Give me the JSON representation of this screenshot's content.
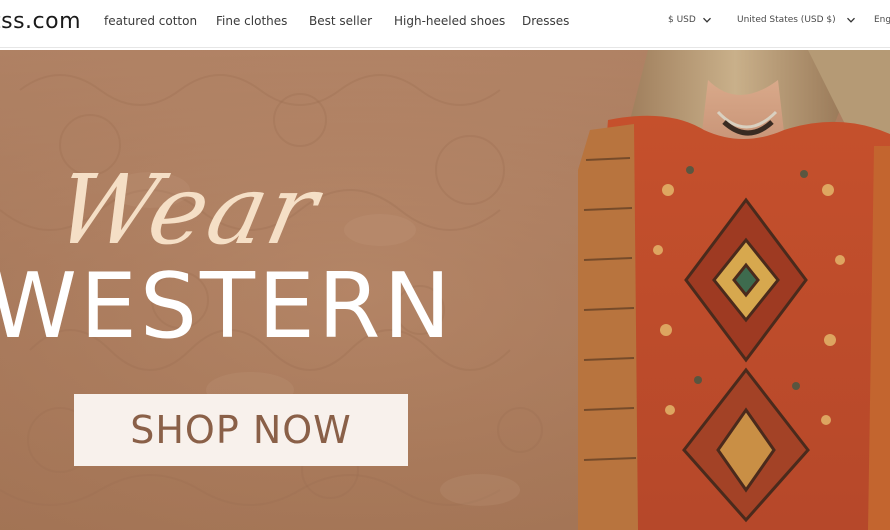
{
  "header": {
    "logo_text": "tss.com",
    "nav": [
      {
        "label": "featured cotton"
      },
      {
        "label": "Fine clothes"
      },
      {
        "label": "Best seller"
      },
      {
        "label": "High-heeled shoes"
      },
      {
        "label": "Dresses"
      }
    ],
    "currency": "$ USD",
    "country": "United States  (USD $)",
    "language": "Eng"
  },
  "hero": {
    "script_text": "Wear",
    "headline": "WESTERN",
    "cta_label": "SHOP NOW"
  },
  "colors": {
    "hero_background": "#b0805f",
    "script_text": "#f5dfc6",
    "cta_background": "#f8f1ec",
    "cta_text": "#8a6048",
    "garment_red": "#c9502b"
  }
}
